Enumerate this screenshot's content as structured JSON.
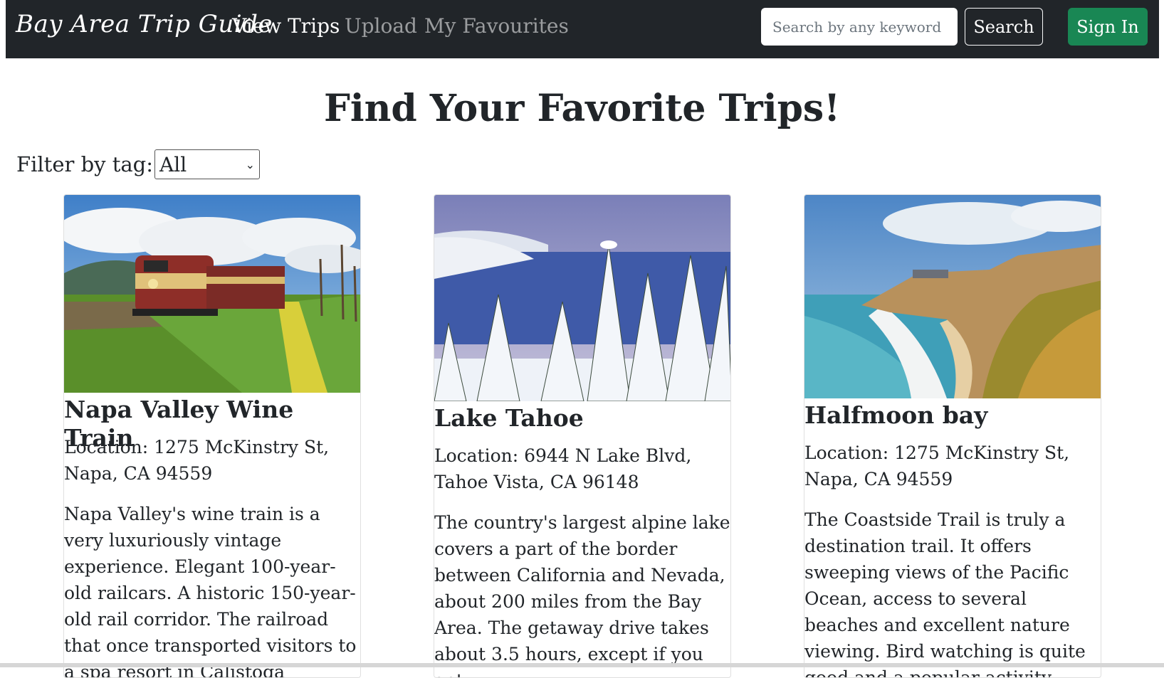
{
  "navbar": {
    "brand": "Bay Area Trip Guide",
    "links": [
      "View Trips",
      "Upload",
      "My Favourites"
    ],
    "search_placeholder": "Search by any keyword",
    "search_label": "Search",
    "signin_label": "Sign In"
  },
  "main": {
    "title": "Find Your Favorite Trips!",
    "filter_label": "Filter by tag:",
    "filter_value": "All"
  },
  "cards": [
    {
      "title": "Napa Valley Wine Train",
      "location": "Location: 1275 McKinstry St, Napa, CA 94559",
      "description": "Napa Valley's wine train is a very luxuriously vintage experience. Elegant 100-year-old railcars. A historic 150-year-old rail corridor. The railroad that once transported visitors to a spa resort in Calistoga"
    },
    {
      "title": "Lake Tahoe",
      "location": "Location: 6944 N Lake Blvd, Tahoe Vista, CA 96148",
      "description": "The country's largest alpine lake covers a part of the border between California and Nevada, about 200 miles from the Bay Area. The getaway drive takes about 3.5 hours, except if you get"
    },
    {
      "title": "Halfmoon bay",
      "location": "Location: 1275 McKinstry St, Napa, CA 94559",
      "description": "The Coastside Trail is truly a destination trail. It offers sweeping views of the Pacific Ocean, access to several beaches and excellent nature viewing. Bird watching is quite good and a popular activity"
    }
  ]
}
